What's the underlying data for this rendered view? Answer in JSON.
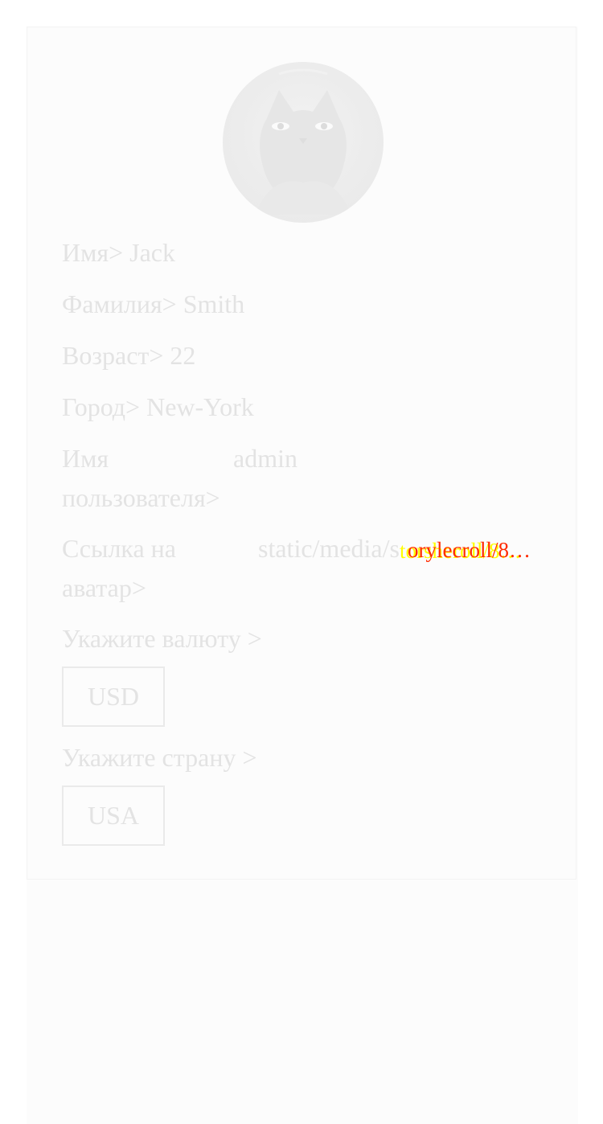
{
  "profile": {
    "name_label": "Имя>",
    "name": "Jack",
    "surname_label": "Фамилия>",
    "surname": "Smith",
    "age_label": "Возраст>",
    "age": "22",
    "city_label": "Город>",
    "city": "New-York",
    "username_label": "Имя пользователя>",
    "username": "admin",
    "avatar_link_label": "Ссылка на аватар>",
    "avatar_link": "static/media/s",
    "avatar_link_overflow_a": "torsheroll/8…",
    "avatar_link_overflow_b": "orylecroll/8…"
  },
  "currency": {
    "label": "Укажите валюту >",
    "selected": "USD"
  },
  "country": {
    "label": "Укажите страну >",
    "selected": "USA"
  },
  "colors": {
    "text": "#e3e3e3",
    "card_background": "#fcfcfc",
    "overflow_yellow": "#ffff00",
    "overflow_red": "#ff2a00"
  },
  "icons": {
    "avatar": "cat-avatar-image"
  }
}
